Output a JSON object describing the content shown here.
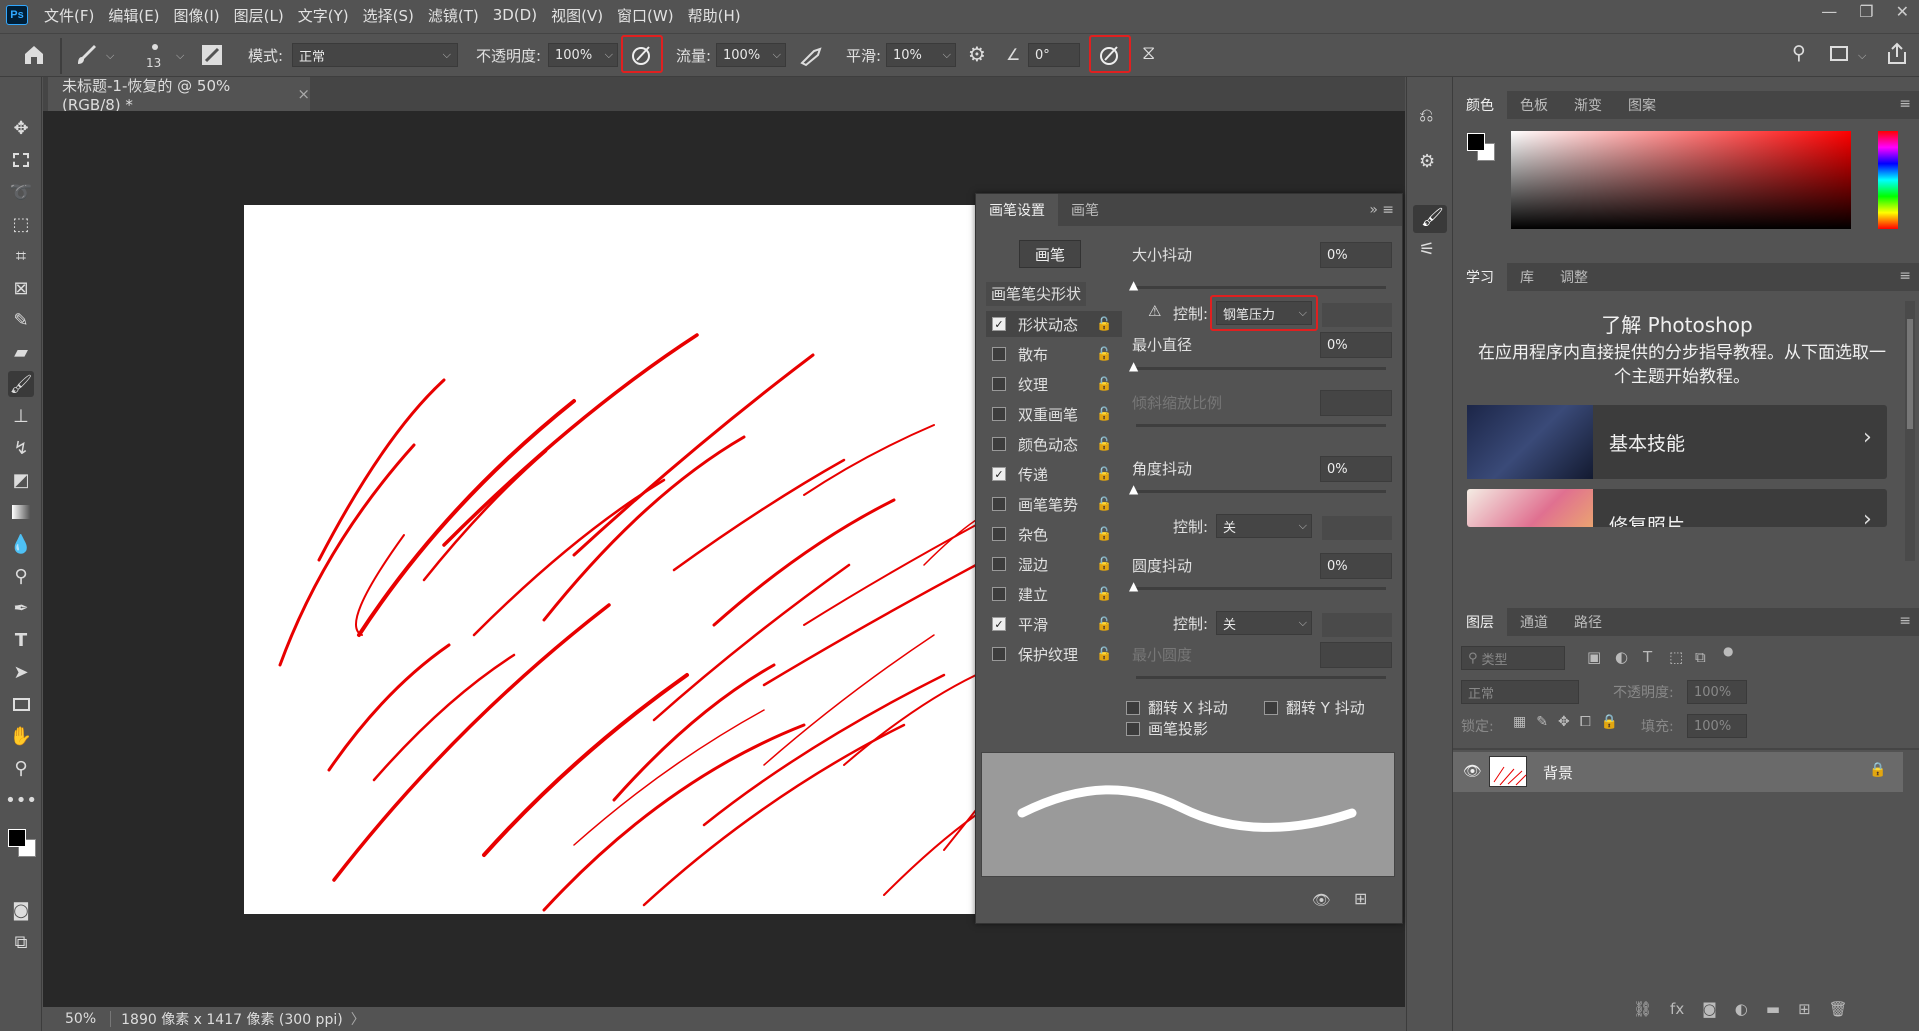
{
  "menubar": {
    "logo": "Ps",
    "items": [
      "文件(F)",
      "编辑(E)",
      "图像(I)",
      "图层(L)",
      "文字(Y)",
      "选择(S)",
      "滤镜(T)",
      "3D(D)",
      "视图(V)",
      "窗口(W)",
      "帮助(H)"
    ],
    "window_controls": [
      "—",
      "❐",
      "✕"
    ]
  },
  "options": {
    "brush_size": "13",
    "mode_label": "模式:",
    "mode_value": "正常",
    "opacity_label": "不透明度:",
    "opacity_value": "100%",
    "flow_label": "流量:",
    "flow_value": "100%",
    "smoothing_label": "平滑:",
    "smoothing_value": "10%",
    "angle_value": "0°"
  },
  "document": {
    "tab_title": "未标题-1-恢复的 @ 50%(RGB/8) *",
    "close_symbol": "×"
  },
  "status": {
    "zoom": "50%",
    "info": "1890 像素 x 1417 像素 (300 ppi)",
    "arrow": "〉"
  },
  "brush_panel": {
    "tabs": [
      "画笔设置",
      "画笔"
    ],
    "brush_button": "画笔",
    "tip_shape": "画笔笔尖形状",
    "options": [
      {
        "label": "形状动态",
        "checked": true
      },
      {
        "label": "散布",
        "checked": false
      },
      {
        "label": "纹理",
        "checked": false
      },
      {
        "label": "双重画笔",
        "checked": false
      },
      {
        "label": "颜色动态",
        "checked": false
      },
      {
        "label": "传递",
        "checked": true
      },
      {
        "label": "画笔笔势",
        "checked": false
      },
      {
        "label": "杂色",
        "checked": false
      },
      {
        "label": "湿边",
        "checked": false
      },
      {
        "label": "建立",
        "checked": false
      },
      {
        "label": "平滑",
        "checked": true
      },
      {
        "label": "保护纹理",
        "checked": false
      }
    ],
    "size_jitter_label": "大小抖动",
    "size_jitter_value": "0%",
    "control_label": "控制:",
    "control_value": "钢笔压力",
    "min_diameter_label": "最小直径",
    "min_diameter_value": "0%",
    "tilt_scale_label": "倾斜缩放比例",
    "angle_jitter_label": "角度抖动",
    "angle_jitter_value": "0%",
    "angle_control_value": "关",
    "roundness_jitter_label": "圆度抖动",
    "roundness_jitter_value": "0%",
    "roundness_control_value": "关",
    "min_roundness_label": "最小圆度",
    "flip_x_label": "翻转 X 抖动",
    "flip_y_label": "翻转 Y 抖动",
    "projection_label": "画笔投影"
  },
  "color_panel": {
    "tabs": [
      "颜色",
      "色板",
      "渐变",
      "图案"
    ],
    "hue_color": "#ff0000"
  },
  "learn_panel": {
    "tabs": [
      "学习",
      "库",
      "调整"
    ],
    "title": "了解 Photoshop",
    "description": "在应用程序内直接提供的分步指导教程。从下面选取一个主题开始教程。",
    "cards": [
      "基本技能",
      "修复照片"
    ]
  },
  "layers_panel": {
    "tabs": [
      "图层",
      "通道",
      "路径"
    ],
    "filter_placeholder": "类型",
    "blend_mode": "正常",
    "opacity_label": "不透明度:",
    "opacity_value": "100%",
    "lock_label": "锁定:",
    "fill_label": "填充:",
    "fill_value": "100%",
    "layer_name": "背景"
  },
  "colors": {
    "highlight": "#e02020",
    "stroke": "#e80000",
    "panel_bg": "#535353",
    "workspace": "#282828"
  }
}
